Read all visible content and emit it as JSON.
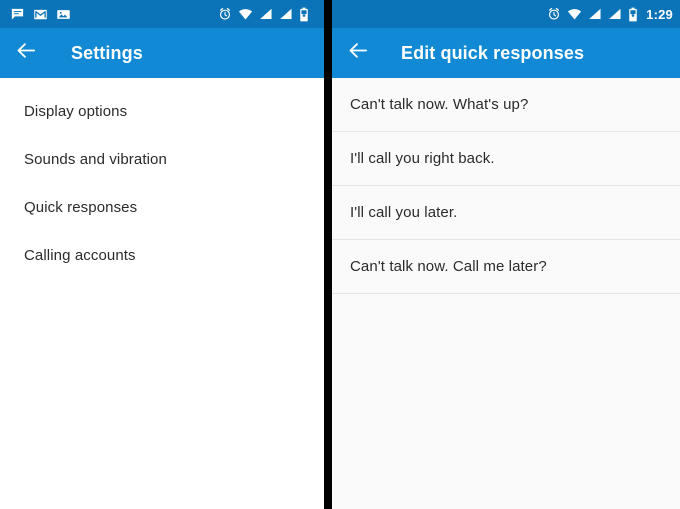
{
  "left_panel": {
    "status_bar": {
      "icons_left": [
        "messages-icon",
        "gmail-icon",
        "photos-icon"
      ],
      "icons_right": [
        "alarm-icon",
        "wifi-icon",
        "signal-sim1-icon",
        "signal-sim2-icon",
        "battery-icon"
      ],
      "clock": ""
    },
    "app_bar": {
      "back_icon": "back-arrow-icon",
      "title": "Settings"
    },
    "items": [
      {
        "label": "Display options"
      },
      {
        "label": "Sounds and vibration"
      },
      {
        "label": "Quick responses"
      },
      {
        "label": "Calling accounts"
      }
    ]
  },
  "right_panel": {
    "status_bar": {
      "icons_right": [
        "alarm-icon",
        "wifi-icon",
        "signal-sim1-icon",
        "signal-sim2-icon",
        "battery-icon"
      ],
      "clock": "1:29"
    },
    "app_bar": {
      "back_icon": "back-arrow-icon",
      "title": "Edit quick responses"
    },
    "items": [
      {
        "label": "Can't talk now. What's up?"
      },
      {
        "label": "I'll call you right back."
      },
      {
        "label": "I'll call you later."
      },
      {
        "label": "Can't talk now. Call me later?"
      }
    ]
  },
  "theme": {
    "status_bar_color": "#0b74b8",
    "app_bar_color": "#1189d4",
    "left_background": "#ffffff",
    "right_background": "#fafafa",
    "divider_color": "#e4e4e4",
    "split_color": "#000000",
    "text_color": "#2b2b2b",
    "on_primary_color": "#ffffff"
  }
}
